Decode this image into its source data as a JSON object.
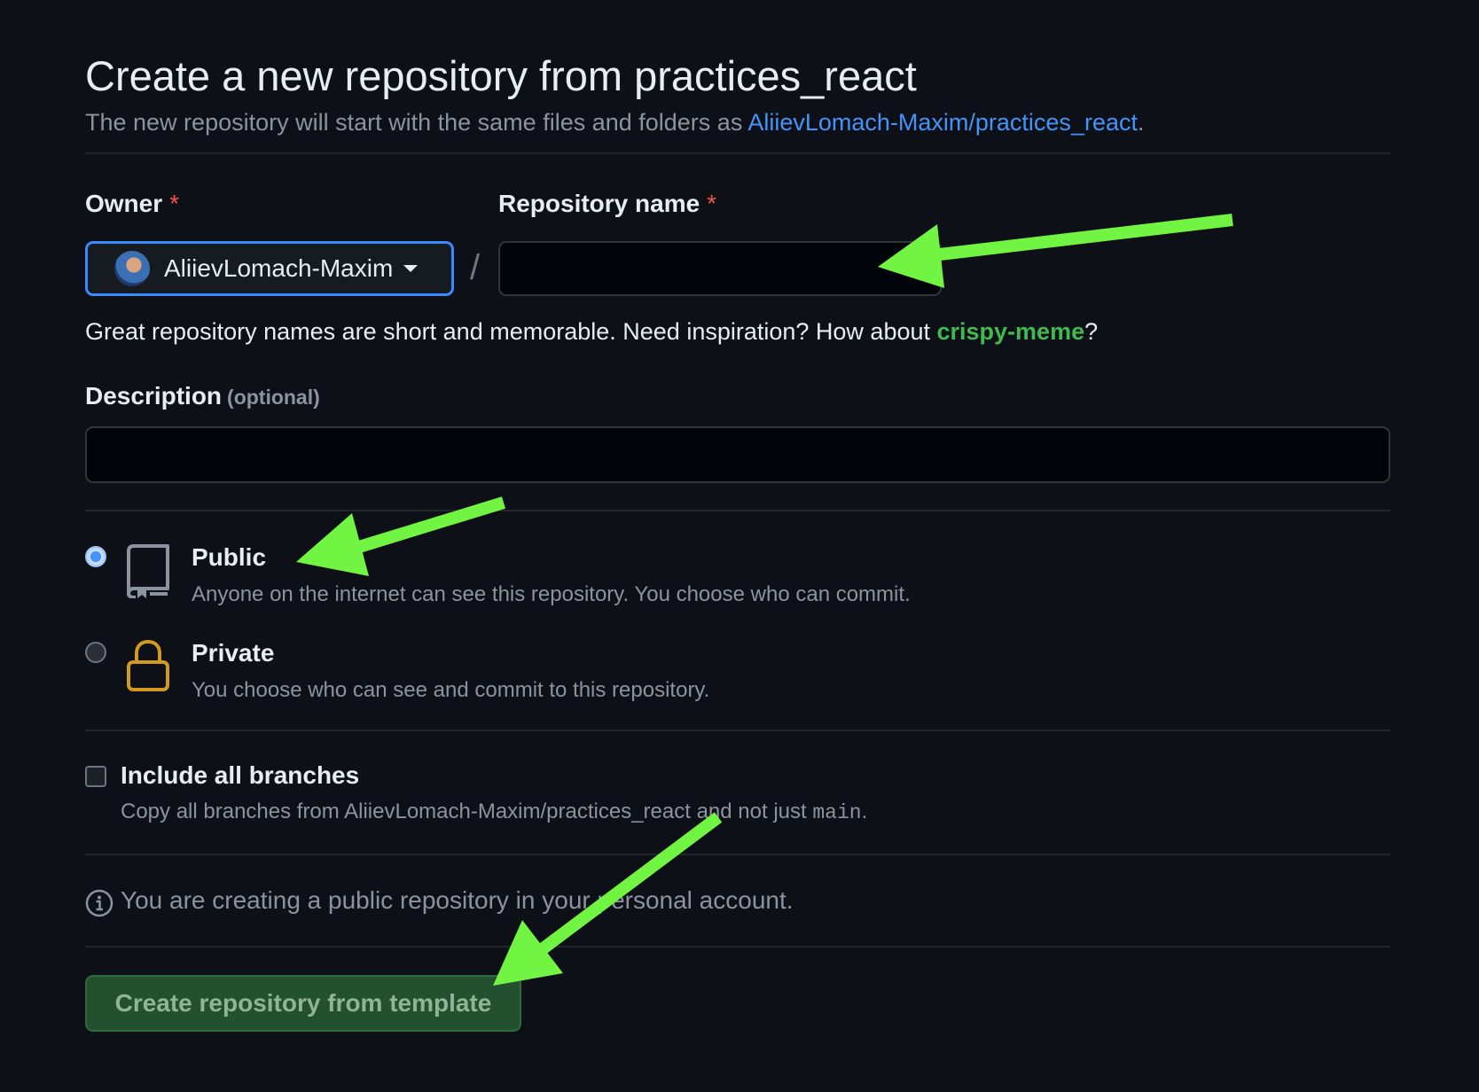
{
  "header": {
    "title": "Create a new repository from practices_react",
    "subtitle_prefix": "The new repository will start with the same files and folders as ",
    "template_link": "AliievLomach-Maxim/practices_react",
    "subtitle_suffix": "."
  },
  "owner": {
    "label": "Owner",
    "required_mark": "*",
    "selected": "AliievLomach-Maxim"
  },
  "separator": "/",
  "repo_name": {
    "label": "Repository name",
    "required_mark": "*",
    "value": "",
    "hint_prefix": "Great repository names are short and memorable. Need inspiration? How about ",
    "suggestion": "crispy-meme",
    "hint_suffix": "?"
  },
  "description": {
    "label": "Description",
    "optional": "(optional)",
    "value": ""
  },
  "visibility": {
    "selected": "public",
    "options": [
      {
        "id": "public",
        "title": "Public",
        "description": "Anyone on the internet can see this repository. You choose who can commit.",
        "icon": "repo-icon"
      },
      {
        "id": "private",
        "title": "Private",
        "description": "You choose who can see and commit to this repository.",
        "icon": "lock-icon"
      }
    ]
  },
  "include_branches": {
    "checked": false,
    "title": "Include all branches",
    "desc_prefix": "Copy all branches from AliievLomach-Maxim/practices_react and not just ",
    "desc_code": "main",
    "desc_suffix": "."
  },
  "info": {
    "icon": "info-icon",
    "text": "You are creating a public repository in your personal account."
  },
  "submit": {
    "label": "Create repository from template"
  },
  "colors": {
    "background": "#0d1117",
    "link": "#4493f8",
    "suggestion": "#3fb950",
    "required": "#f85149",
    "annotation_arrow": "#72f542",
    "lock": "#d29922"
  }
}
